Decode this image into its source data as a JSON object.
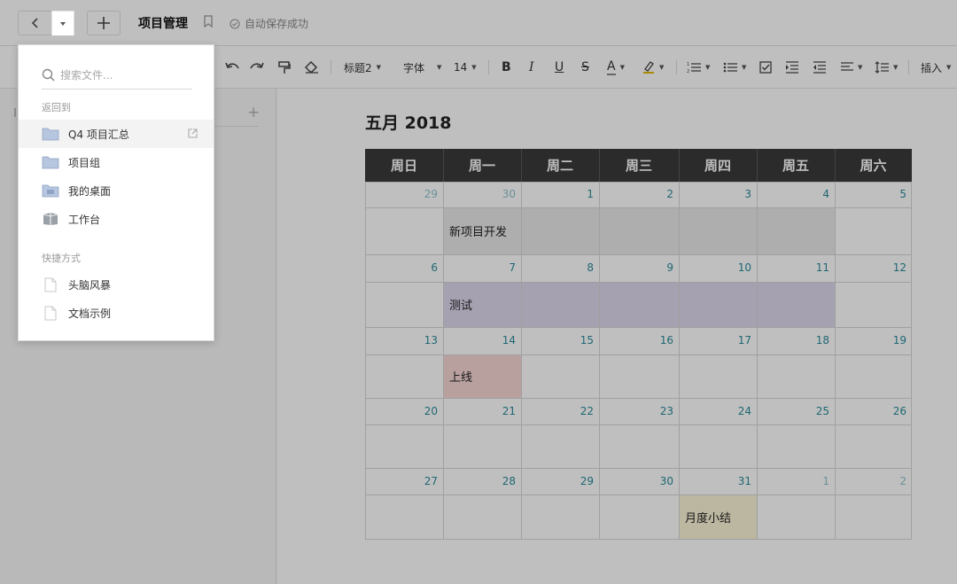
{
  "topbar": {
    "doc_title": "项目管理",
    "save_status": "自动保存成功"
  },
  "toolbar": {
    "heading": "标题2",
    "font": "字体",
    "font_size": "14",
    "insert": "插入"
  },
  "calendar": {
    "title": "五月 2018",
    "weekdays": [
      "周日",
      "周一",
      "周二",
      "周三",
      "周四",
      "周五",
      "周六"
    ],
    "weeks": [
      [
        "29",
        "30",
        "1",
        "2",
        "3",
        "4",
        "5"
      ],
      [
        "6",
        "7",
        "8",
        "9",
        "10",
        "11",
        "12"
      ],
      [
        "13",
        "14",
        "15",
        "16",
        "17",
        "18",
        "19"
      ],
      [
        "20",
        "21",
        "22",
        "23",
        "24",
        "25",
        "26"
      ],
      [
        "27",
        "28",
        "29",
        "30",
        "31",
        "1",
        "2"
      ]
    ],
    "events": [
      {
        "label": "新项目开发",
        "color": "#e8e8e8"
      },
      {
        "label": "测试",
        "color": "#dcd7ec"
      },
      {
        "label": "上线",
        "color": "#f6d6d4"
      },
      {
        "label": "月度小结",
        "color": "#fbf5d6"
      }
    ]
  },
  "dropdown": {
    "search_placeholder": "搜索文件...",
    "back_to_label": "返回到",
    "back_items": [
      {
        "label": "Q4 项目汇总",
        "icon": "folder-icon"
      },
      {
        "label": "项目组",
        "icon": "folder-icon"
      },
      {
        "label": "我的桌面",
        "icon": "desktop-folder-icon"
      },
      {
        "label": "工作台",
        "icon": "workspace-icon"
      }
    ],
    "shortcuts_label": "快捷方式",
    "shortcut_items": [
      {
        "label": "头脑风暴",
        "icon": "document-icon"
      },
      {
        "label": "文档示例",
        "icon": "document-icon"
      }
    ]
  },
  "colors": {
    "accent_teal": "#2a8a9a",
    "calendar_header": "#3a3a3a",
    "folder_blue": "#b7c6df"
  }
}
